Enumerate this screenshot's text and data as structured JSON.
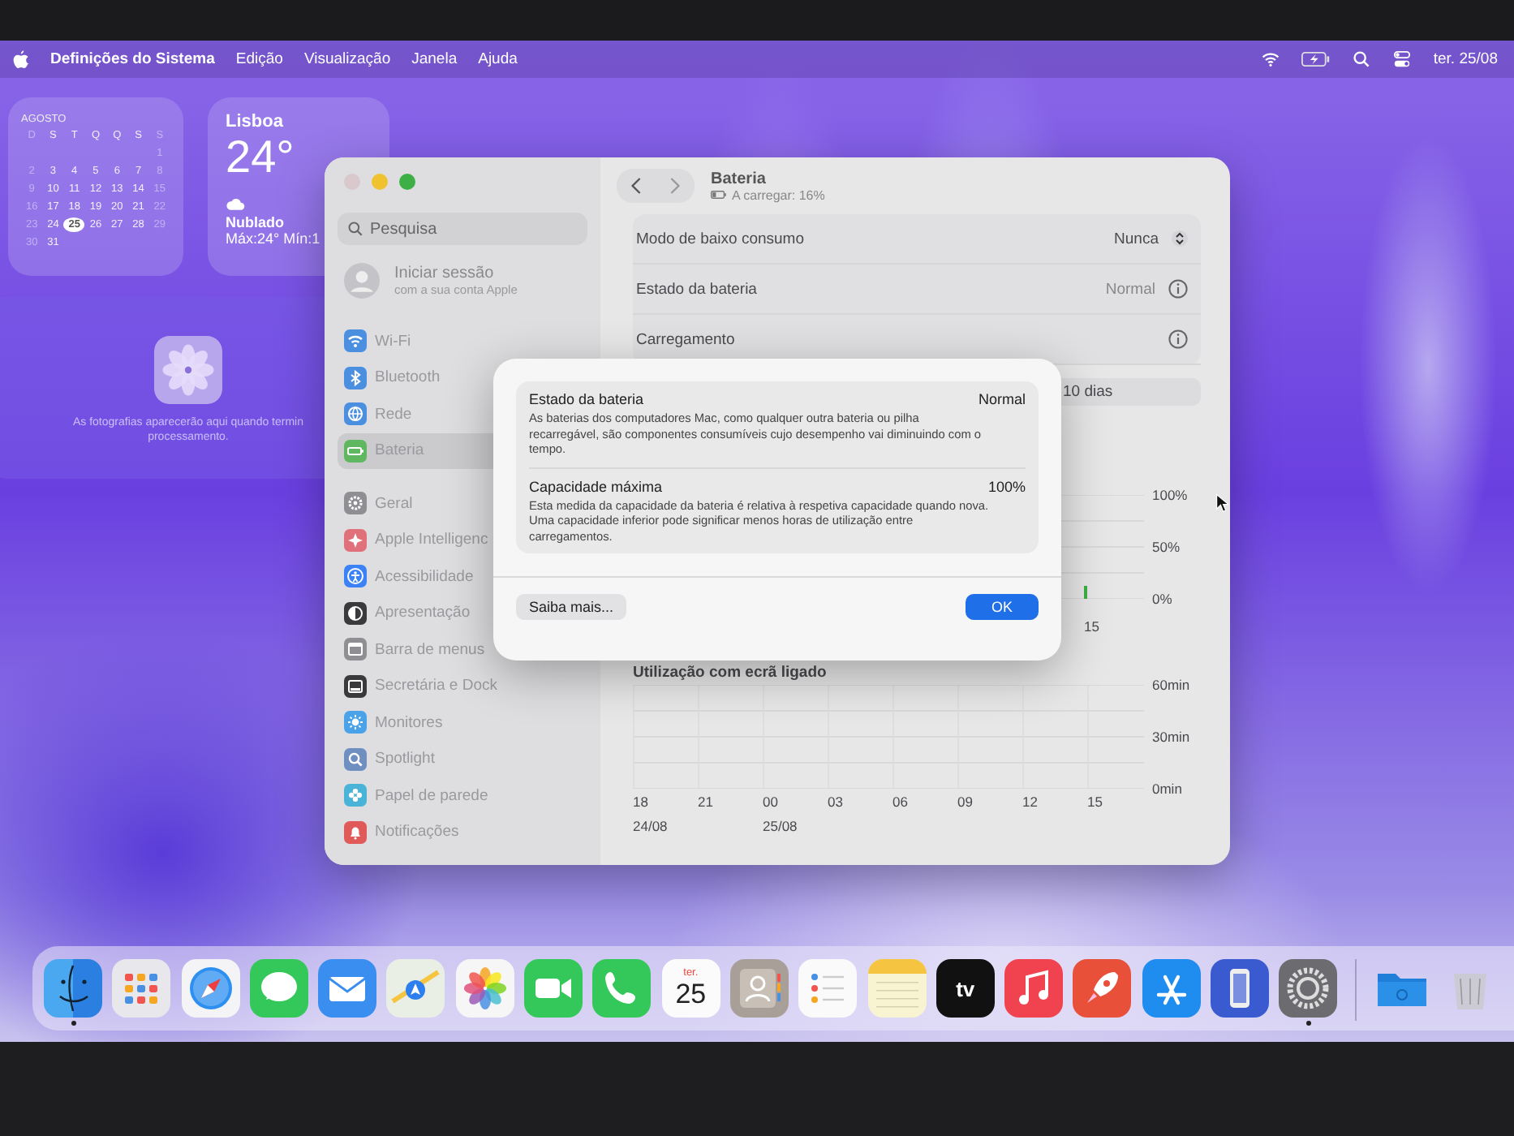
{
  "menu_bar": {
    "app_name": "Definições do Sistema",
    "menus": [
      "Edição",
      "Visualização",
      "Janela",
      "Ajuda"
    ],
    "clock": "ter. 25/08"
  },
  "calendar_widget": {
    "month": "AGOSTO",
    "weekdays": [
      "D",
      "S",
      "T",
      "Q",
      "Q",
      "S",
      "S"
    ],
    "weeks": [
      [
        {
          "day": "1",
          "selected": false
        }
      ],
      [
        {
          "day": "2",
          "selected": false
        },
        {
          "day": "3",
          "selected": false
        },
        {
          "day": "4",
          "selected": false
        },
        {
          "day": "5",
          "selected": false
        },
        {
          "day": "6",
          "selected": false
        },
        {
          "day": "7",
          "selected": false
        },
        {
          "day": "8",
          "selected": false
        }
      ],
      [
        {
          "day": "9",
          "selected": false
        },
        {
          "day": "10",
          "selected": false
        },
        {
          "day": "11",
          "selected": false
        },
        {
          "day": "12",
          "selected": false
        },
        {
          "day": "13",
          "selected": false
        },
        {
          "day": "14",
          "selected": false
        },
        {
          "day": "15",
          "selected": false
        }
      ],
      [
        {
          "day": "16",
          "selected": false
        },
        {
          "day": "17",
          "selected": false
        },
        {
          "day": "18",
          "selected": false
        },
        {
          "day": "19",
          "selected": false
        },
        {
          "day": "20",
          "selected": false
        },
        {
          "day": "21",
          "selected": false
        },
        {
          "day": "22",
          "selected": false
        }
      ],
      [
        {
          "day": "23",
          "selected": false
        },
        {
          "day": "24",
          "selected": false
        },
        {
          "day": "25",
          "selected": true
        },
        {
          "day": "26",
          "selected": false
        },
        {
          "day": "27",
          "selected": false
        },
        {
          "day": "28",
          "selected": false
        },
        {
          "day": "29",
          "selected": false
        }
      ],
      [
        {
          "day": "30",
          "selected": false
        },
        {
          "day": "31",
          "selected": false
        }
      ]
    ]
  },
  "weather_widget": {
    "city": "Lisboa",
    "temperature": "24°",
    "condition": "Nublado",
    "range": "Máx:24° Mín:1"
  },
  "photos_widget": {
    "message_lines": [
      "As fotografias aparecerão aqui quando termin",
      "processamento."
    ]
  },
  "settings_window": {
    "search": {
      "placeholder": "Pesquisa"
    },
    "account": {
      "title": "Iniciar sessão",
      "subtitle": "com a sua conta Apple"
    },
    "sidebar_groups": [
      [
        {
          "kind": "wifi",
          "label": "Wi-Fi",
          "color": "#4a8fe0",
          "selected": false
        },
        {
          "kind": "bluetooth",
          "label": "Bluetooth",
          "color": "#4a8fe0",
          "selected": false
        },
        {
          "kind": "network",
          "label": "Rede",
          "color": "#4a8fe0",
          "selected": false
        },
        {
          "kind": "battery",
          "label": "Bateria",
          "color": "#5fb760",
          "selected": true
        }
      ],
      [
        {
          "kind": "gear",
          "label": "Geral",
          "color": "#8e8e93",
          "selected": false
        },
        {
          "kind": "sparkle",
          "label": "Apple Intelligenc",
          "color": "#e0707a",
          "selected": false
        },
        {
          "kind": "person",
          "label": "Acessibilidade",
          "color": "#3b82f6",
          "selected": false
        },
        {
          "kind": "halfcircle",
          "label": "Apresentação",
          "color": "#3a3a3c",
          "selected": false
        },
        {
          "kind": "menubar",
          "label": "Barra de menus",
          "color": "#8e8e93",
          "selected": false
        },
        {
          "kind": "dock",
          "label": "Secretária e Dock",
          "color": "#3a3a3c",
          "selected": false
        },
        {
          "kind": "sun",
          "label": "Monitores",
          "color": "#4aa3e8",
          "selected": false
        },
        {
          "kind": "search",
          "label": "Spotlight",
          "color": "#6f8fc0",
          "selected": false
        },
        {
          "kind": "flower",
          "label": "Papel de parede",
          "color": "#4ab3d8",
          "selected": false
        },
        {
          "kind": "bell",
          "label": "Notificações",
          "color": "#e05a5a",
          "selected": false
        }
      ]
    ],
    "header": {
      "title": "Bateria",
      "status": "A carregar: 16%"
    },
    "settings_rows": [
      {
        "kind": "popup",
        "label": "Modo de baixo consumo",
        "value": "Nunca"
      },
      {
        "kind": "info",
        "label": "Estado da bateria",
        "value": "Normal"
      },
      {
        "kind": "info",
        "label": "Carregamento"
      }
    ],
    "range_segment": "10 dias",
    "battery_chart": {
      "y_ticks": [
        "100%",
        "50%",
        "0%"
      ],
      "x_ticks": [
        "15"
      ]
    },
    "usage_chart": {
      "title": "Utilização com ecrã ligado",
      "y_ticks": [
        "60min",
        "30min",
        "0min"
      ],
      "x_ticks": [
        {
          "label": "18",
          "date": "24/08"
        },
        {
          "label": "21"
        },
        {
          "label": "00",
          "date": "25/08"
        },
        {
          "label": "03"
        },
        {
          "label": "06"
        },
        {
          "label": "09"
        },
        {
          "label": "12"
        },
        {
          "label": "15"
        }
      ]
    }
  },
  "dialog": {
    "sections": [
      {
        "title": "Estado da bateria",
        "value": "Normal",
        "description": "As baterias dos computadores Mac, como qualquer outra bateria ou pilha recarregável, são componentes consumíveis cujo desempenho vai diminuindo com o tempo."
      },
      {
        "title": "Capacidade máxima",
        "value": "100%",
        "description": "Esta medida da capacidade da bateria é relativa à respetiva capacidade quando nova. Uma capacidade inferior pode significar menos horas de utilização entre carregamentos."
      }
    ],
    "buttons": [
      {
        "kind": "secondary",
        "label": "Saiba mais..."
      },
      {
        "kind": "default",
        "label": "OK"
      }
    ]
  },
  "dock": {
    "apps": [
      {
        "kind": "finder",
        "running": true
      },
      {
        "kind": "launchpad",
        "running": false
      },
      {
        "kind": "safari",
        "running": false
      },
      {
        "kind": "messages",
        "running": false
      },
      {
        "kind": "mail",
        "running": false
      },
      {
        "kind": "maps",
        "running": false
      },
      {
        "kind": "photos",
        "running": false
      },
      {
        "kind": "facetime",
        "running": false
      },
      {
        "kind": "phone",
        "running": false
      },
      {
        "kind": "calendar",
        "running": false,
        "weekday": "ter.",
        "day": "25"
      },
      {
        "kind": "contacts",
        "running": false
      },
      {
        "kind": "reminders",
        "running": false
      },
      {
        "kind": "notes",
        "running": false
      },
      {
        "kind": "tv",
        "running": false,
        "label": "tv"
      },
      {
        "kind": "music",
        "running": false
      },
      {
        "kind": "rocket",
        "running": false
      },
      {
        "kind": "appstore",
        "running": false
      },
      {
        "kind": "mirroring",
        "running": false
      },
      {
        "kind": "settings",
        "running": true
      }
    ],
    "extras": [
      {
        "kind": "folder"
      },
      {
        "kind": "trash"
      }
    ]
  }
}
